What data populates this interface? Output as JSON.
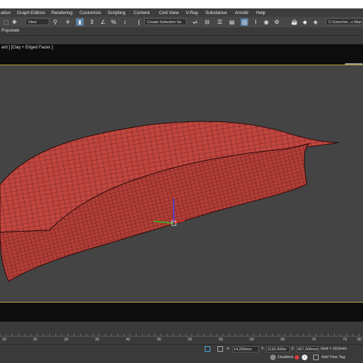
{
  "menu": {
    "items": [
      "ation",
      "Graph Editors",
      "Rendering",
      "Customize",
      "Scripting",
      "Content",
      "Civil View",
      "V-Ray",
      "Substance",
      "Arnold",
      "Help"
    ]
  },
  "toolbar": {
    "view_dropdown": "View",
    "selection_set_placeholder": "Create Selection Se",
    "path_field": "C:\\Users\\m...s Max 2"
  },
  "ribbon": {
    "label": "Populate"
  },
  "viewport": {
    "label": "ard ] [Clay + Edged Faces ]",
    "model_color": "#c1463f",
    "wire_color": "#3a0f0f",
    "background": "#444444"
  },
  "timeline": {
    "ticks": [
      "20",
      "25",
      "30",
      "35",
      "40",
      "45",
      "50",
      "55",
      "60",
      "65",
      "70",
      "75",
      "80"
    ]
  },
  "status": {
    "x_label": "X:",
    "x_value": "14,269mm",
    "y_label": "Y:",
    "y_value": "2118,439m",
    "z_label": "Z:",
    "z_value": "667,006mm",
    "grid": "Grid = 10,0mm",
    "disabled": "Disabled:",
    "add_time_tag": "Add Time Tag"
  }
}
